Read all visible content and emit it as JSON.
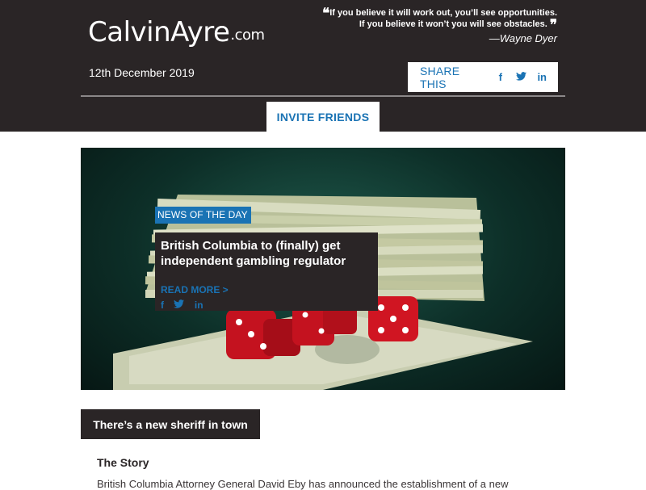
{
  "header": {
    "logo_main": "CalvinAyre",
    "logo_tld": ".com",
    "quote_line1": "If you believe it will work out, you’ll see opportunities.",
    "quote_line2": "If you believe it won’t you will see obstacles.",
    "quote_author": "—Wayne Dyer",
    "date": "12th December 2019",
    "share_label": "SHARE THIS",
    "share_icons": [
      "facebook-icon",
      "twitter-icon",
      "linkedin-icon"
    ],
    "invite_label": "INVITE FRIENDS"
  },
  "hero": {
    "tag": "NEWS OF THE DAY",
    "headline": "British Columbia to (finally) get independent gambling regulator",
    "read_more": "READ MORE >"
  },
  "article": {
    "section_title": "There’s a new sheriff in town",
    "story_heading": "The Story",
    "story_text": "British Columbia Attorney General David Eby has announced the establishment of a new"
  },
  "colors": {
    "dark": "#2a2526",
    "accent": "#1a73b4",
    "white": "#ffffff"
  }
}
